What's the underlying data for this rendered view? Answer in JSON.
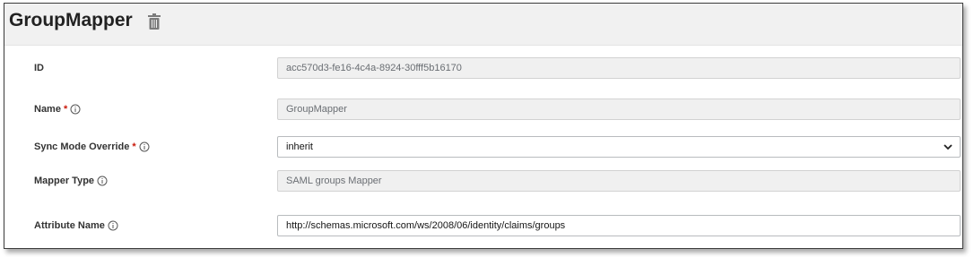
{
  "header": {
    "title": "GroupMapper",
    "delete_icon": "trash-icon"
  },
  "form": {
    "id": {
      "label": "ID",
      "value": "acc570d3-fe16-4c4a-8924-30fff5b16170"
    },
    "name": {
      "label": "Name",
      "required": "*",
      "value": "GroupMapper"
    },
    "sync_mode": {
      "label": "Sync Mode Override",
      "required": "*",
      "value": "inherit"
    },
    "mapper_type": {
      "label": "Mapper Type",
      "value": "SAML groups Mapper"
    },
    "attribute_name": {
      "label": "Attribute Name",
      "value": "http://schemas.microsoft.com/ws/2008/06/identity/claims/groups"
    }
  },
  "colors": {
    "required": "#c9190b",
    "header_bg": "#f1f1f1",
    "readonly_bg": "#f0f0f0"
  }
}
